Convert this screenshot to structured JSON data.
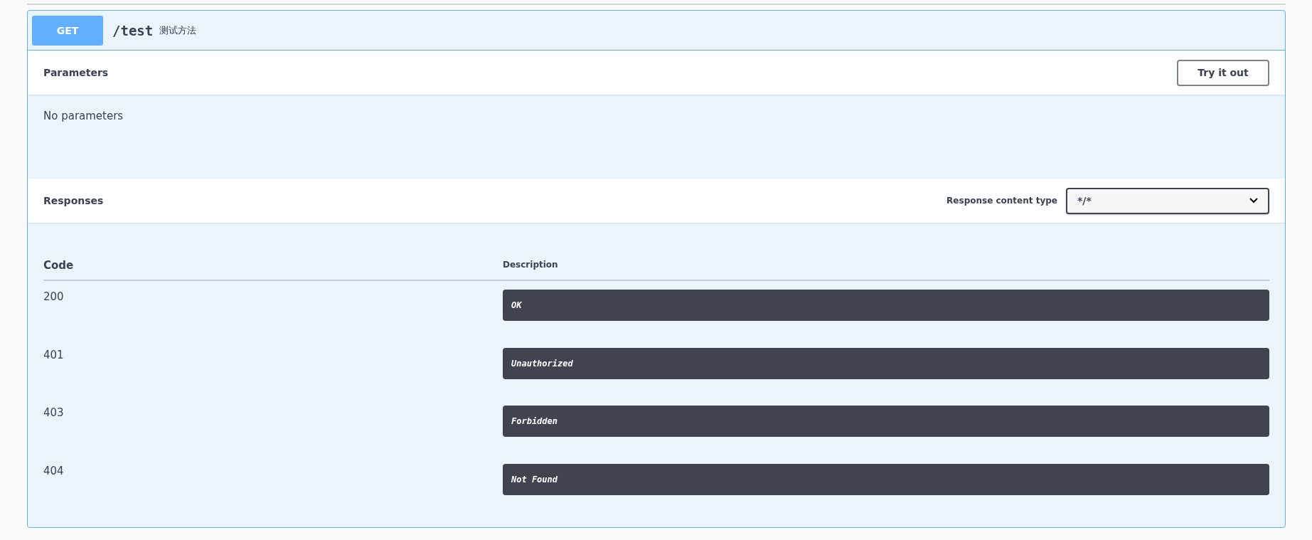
{
  "operation": {
    "method": "GET",
    "path": "/test",
    "summary": "测试方法"
  },
  "parameters": {
    "title": "Parameters",
    "try_button": "Try it out",
    "empty_text": "No parameters"
  },
  "responses": {
    "title": "Responses",
    "content_type_label": "Response content type",
    "content_type": "*/*",
    "columns": [
      "Code",
      "Description"
    ],
    "rows": [
      {
        "code": "200",
        "description": "OK"
      },
      {
        "code": "401",
        "description": "Unauthorized"
      },
      {
        "code": "403",
        "description": "Forbidden"
      },
      {
        "code": "404",
        "description": "Not Found"
      }
    ]
  }
}
